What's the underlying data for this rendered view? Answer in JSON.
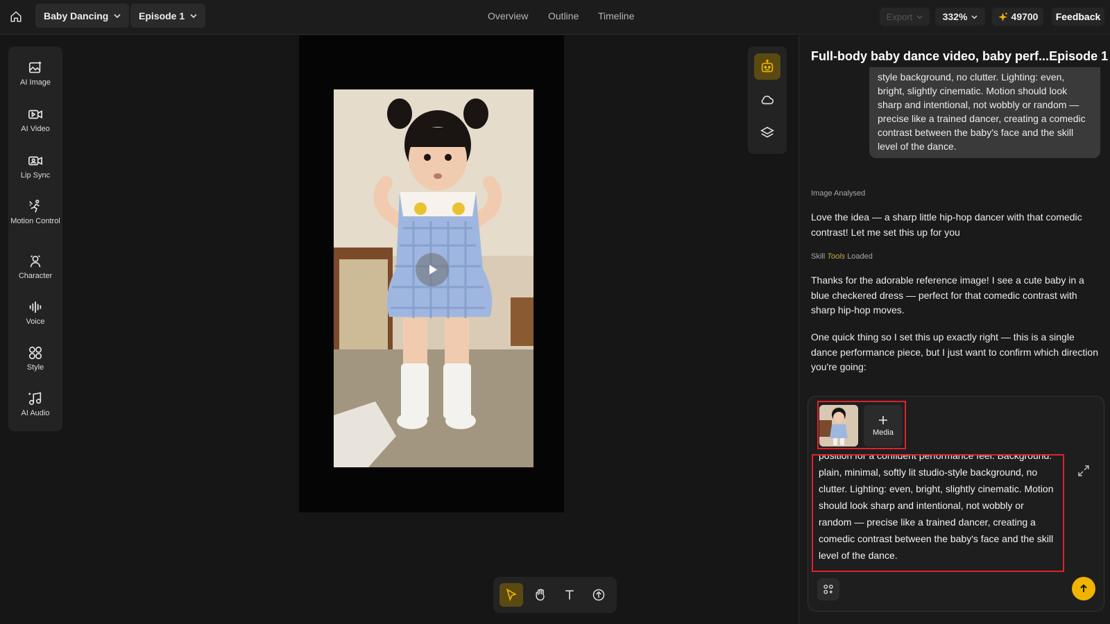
{
  "topbar": {
    "project": "Baby Dancing",
    "episode": "Episode 1",
    "nav": [
      "Overview",
      "Outline",
      "Timeline"
    ],
    "export_label": "Export",
    "zoom": "332%",
    "credits": "49700",
    "feedback_label": "Feedback"
  },
  "tools": [
    {
      "icon": "ai-image-icon",
      "label": "AI Image"
    },
    {
      "icon": "ai-video-icon",
      "label": "AI Video"
    },
    {
      "icon": "lip-sync-icon",
      "label": "Lip Sync"
    },
    {
      "icon": "motion-control-icon",
      "label": "Motion Control"
    },
    {
      "icon": "character-icon",
      "label": "Character"
    },
    {
      "icon": "voice-icon",
      "label": "Voice"
    },
    {
      "icon": "style-icon",
      "label": "Style"
    },
    {
      "icon": "ai-audio-icon",
      "label": "AI Audio"
    }
  ],
  "panel": {
    "title": "Full-body baby dance video, baby perf...",
    "episode_tag": "Episode 1",
    "user_prompt_tail": "style background, no clutter. Lighting: even, bright, slightly cinematic. Motion should look sharp and intentional, not wobbly or random — precise like a trained dancer, creating a comedic contrast between the baby's face and the skill level of the dance.",
    "status_image": "Image Analysed",
    "msg1": "Love the idea — a sharp little hip-hop dancer with that comedic contrast! Let me set this up for you",
    "skill_prefix": "Skill",
    "skill_tools": "Tools",
    "skill_suffix": "Loaded",
    "msg2": "Thanks for the adorable reference image! I see a cute baby in a blue checkered dress — perfect for that comedic contrast with sharp hip-hop moves.",
    "msg3": "One quick thing so I set this up exactly right — this is a single dance performance piece, but I just want to confirm which direction you're going:"
  },
  "composer": {
    "media_label": "Media",
    "text": "position for a confident performance feel. Background: plain, minimal, softly lit studio-style background, no clutter. Lighting: even, bright, slightly cinematic. Motion should look sharp and intentional, not wobbly or random — precise like a trained dancer, creating a comedic contrast between the baby's face and the skill level of the dance."
  },
  "colors": {
    "accent": "#f0b400",
    "highlight": "#e0222a",
    "active_tool": "#5a4a12"
  }
}
